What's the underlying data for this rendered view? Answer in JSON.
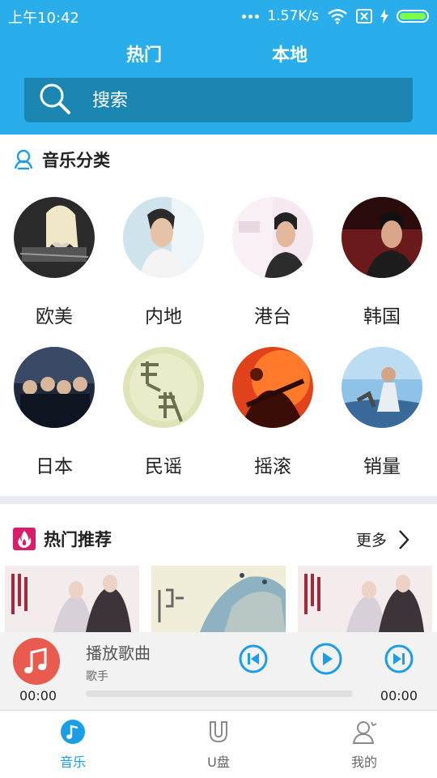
{
  "status_bar": {
    "time": "上午10:42",
    "speed": "1.57K/s",
    "battery_level": 1.0
  },
  "tabs": [
    {
      "label": "热门",
      "active": true
    },
    {
      "label": "本地",
      "active": false
    }
  ],
  "search": {
    "label": "搜索"
  },
  "categories": {
    "title": "音乐分类",
    "items": [
      {
        "label": "欧美"
      },
      {
        "label": "内地"
      },
      {
        "label": "港台"
      },
      {
        "label": "韩国"
      },
      {
        "label": "日本"
      },
      {
        "label": "民谣"
      },
      {
        "label": "摇滚"
      },
      {
        "label": "销量"
      }
    ]
  },
  "hot": {
    "title": "热门推荐",
    "more_label": "更多"
  },
  "player": {
    "song_title": "播放歌曲",
    "artist": "歌手",
    "time_current": "00:00",
    "time_total": "00:00",
    "progress": 0
  },
  "bottom_nav": [
    {
      "label": "音乐",
      "active": true
    },
    {
      "label": "U盘",
      "active": false
    },
    {
      "label": "我的",
      "active": false
    }
  ],
  "colors": {
    "header": "#29aeeb",
    "search_bg": "#1c86b2",
    "accent": "#1a9ee6",
    "disc": "#e95a4f",
    "hot_icon": "#d81e6b"
  }
}
